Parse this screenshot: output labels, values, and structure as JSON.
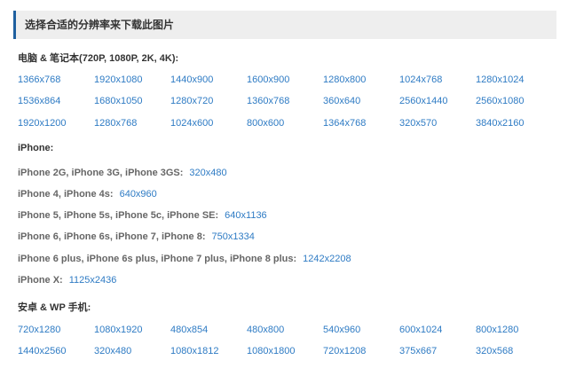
{
  "header": {
    "title": "选择合适的分辨率来下载此图片"
  },
  "desktop": {
    "title": "电脑 & 笔记本(720P, 1080P, 2K, 4K):",
    "rows": [
      [
        "1366x768",
        "1920x1080",
        "1440x900",
        "1600x900",
        "1280x800",
        "1024x768",
        "1280x1024"
      ],
      [
        "1536x864",
        "1680x1050",
        "1280x720",
        "1360x768",
        "360x640",
        "2560x1440",
        "2560x1080"
      ],
      [
        "1920x1200",
        "1280x768",
        "1024x600",
        "800x600",
        "1364x768",
        "320x570",
        "3840x2160"
      ]
    ]
  },
  "iphone": {
    "title": "iPhone:",
    "items": [
      {
        "models": "iPhone 2G, iPhone 3G, iPhone 3GS:",
        "resolution": "320x480"
      },
      {
        "models": "iPhone 4, iPhone 4s:",
        "resolution": "640x960"
      },
      {
        "models": "iPhone 5, iPhone 5s, iPhone 5c, iPhone SE:",
        "resolution": "640x1136"
      },
      {
        "models": "iPhone 6, iPhone 6s, iPhone 7, iPhone 8:",
        "resolution": "750x1334"
      },
      {
        "models": "iPhone 6 plus, iPhone 6s plus, iPhone 7 plus, iPhone 8 plus:",
        "resolution": "1242x2208"
      },
      {
        "models": "iPhone X:",
        "resolution": "1125x2436"
      }
    ]
  },
  "android": {
    "title": "安卓 & WP 手机:",
    "rows": [
      [
        "720x1280",
        "1080x1920",
        "480x854",
        "480x800",
        "540x960",
        "600x1024",
        "800x1280"
      ],
      [
        "1440x2560",
        "320x480",
        "1080x1812",
        "1080x1800",
        "720x1208",
        "375x667",
        "320x568"
      ]
    ]
  },
  "colors": {
    "accent": "#1e5f9f",
    "link": "#2e7bc4",
    "header_bg": "#eeeeee"
  }
}
